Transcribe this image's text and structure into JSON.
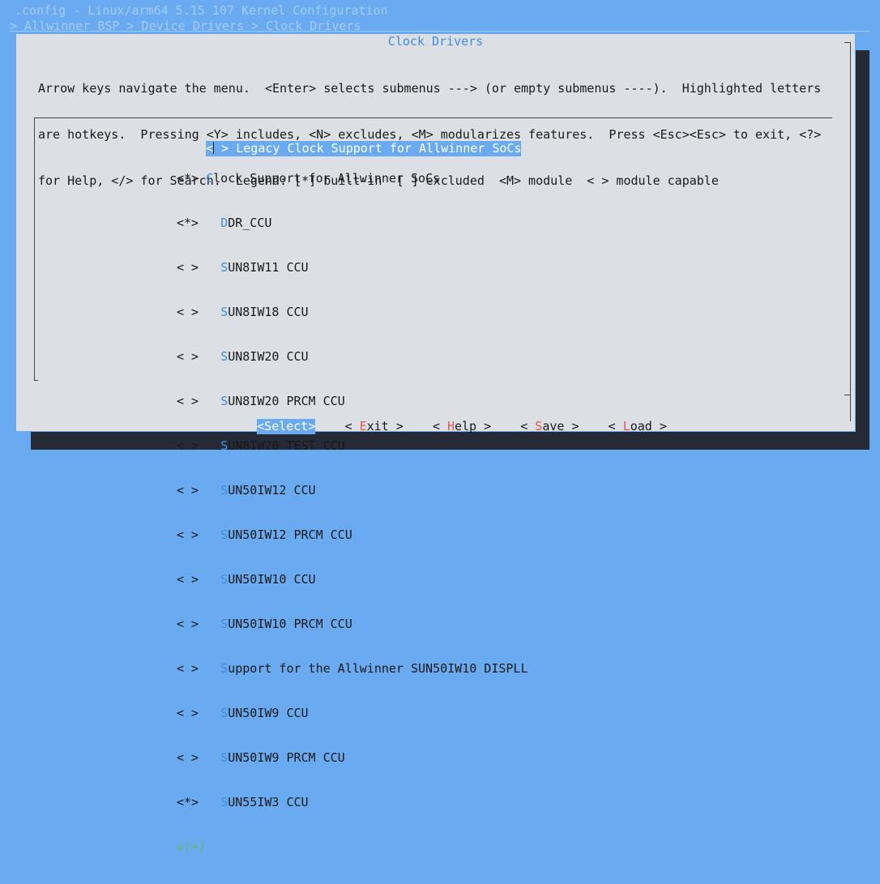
{
  "window": {
    "title": ".config - Linux/arm64 5.15 107 Kernel Configuration",
    "breadcrumb": "> Allwinner BSP > Device Drivers > Clock Drivers"
  },
  "dialog": {
    "title": "Clock Drivers",
    "help_lines": [
      "Arrow keys navigate the menu.  <Enter> selects submenus ---> (or empty submenus ----).  Highlighted letters",
      "are hotkeys.  Pressing <Y> includes, <N> excludes, <M> modularizes features.  Press <Esc><Esc> to exit, <?>",
      "for Help, </> for Search.  Legend: [*] built-in  [ ] excluded  <M> module  < > module capable"
    ]
  },
  "menu": {
    "items": [
      {
        "state": "< >",
        "indent": " ",
        "hotkey": "L",
        "rest": "egacy Clock Support for Allwinner SoCs",
        "selected": true
      },
      {
        "state": "<*>",
        "indent": " ",
        "hotkey": "C",
        "rest": "lock Support for Allwinner SoCs",
        "selected": false
      },
      {
        "state": "<*>",
        "indent": "   ",
        "hotkey": "D",
        "rest": "DR_CCU",
        "selected": false
      },
      {
        "state": "< >",
        "indent": "   ",
        "hotkey": "S",
        "rest": "UN8IW11 CCU",
        "selected": false
      },
      {
        "state": "< >",
        "indent": "   ",
        "hotkey": "S",
        "rest": "UN8IW18 CCU",
        "selected": false
      },
      {
        "state": "< >",
        "indent": "   ",
        "hotkey": "S",
        "rest": "UN8IW20 CCU",
        "selected": false
      },
      {
        "state": "< >",
        "indent": "   ",
        "hotkey": "S",
        "rest": "UN8IW20 PRCM CCU",
        "selected": false
      },
      {
        "state": "< >",
        "indent": "   ",
        "hotkey": "S",
        "rest": "UN8IW20 TEST CCU",
        "selected": false
      },
      {
        "state": "< >",
        "indent": "   ",
        "hotkey": "S",
        "rest": "UN50IW12 CCU",
        "selected": false
      },
      {
        "state": "< >",
        "indent": "   ",
        "hotkey": "S",
        "rest": "UN50IW12 PRCM CCU",
        "selected": false
      },
      {
        "state": "< >",
        "indent": "   ",
        "hotkey": "S",
        "rest": "UN50IW10 CCU",
        "selected": false
      },
      {
        "state": "< >",
        "indent": "   ",
        "hotkey": "S",
        "rest": "UN50IW10 PRCM CCU",
        "selected": false
      },
      {
        "state": "< >",
        "indent": "   ",
        "hotkey": "S",
        "rest": "upport for the Allwinner SUN50IW10 DISPLL",
        "selected": false
      },
      {
        "state": "< >",
        "indent": "   ",
        "hotkey": "S",
        "rest": "UN50IW9 CCU",
        "selected": false
      },
      {
        "state": "< >",
        "indent": "   ",
        "hotkey": "S",
        "rest": "UN50IW9 PRCM CCU",
        "selected": false
      },
      {
        "state": "<*>",
        "indent": "   ",
        "hotkey": "S",
        "rest": "UN55IW3 CCU",
        "selected": false
      }
    ],
    "more_indicator": "v(+)"
  },
  "buttons": [
    {
      "open": "<",
      "hotkey": "S",
      "rest": "elect",
      "close": ">",
      "selected": true
    },
    {
      "open": "< ",
      "hotkey": "E",
      "rest": "xit",
      "close": " >",
      "selected": false
    },
    {
      "open": "< ",
      "hotkey": "H",
      "rest": "elp",
      "close": " >",
      "selected": false
    },
    {
      "open": "< ",
      "hotkey": "S",
      "rest": "ave",
      "close": " >",
      "selected": false
    },
    {
      "open": "< ",
      "hotkey": "L",
      "rest": "oad",
      "close": " >",
      "selected": false
    }
  ],
  "colors": {
    "background": "#6aaaf0",
    "dialog": "#dcdfe4",
    "accent": "#3f8ee0",
    "button_hotkey": "#e05a4a",
    "more_indicator": "#6fb86a"
  }
}
